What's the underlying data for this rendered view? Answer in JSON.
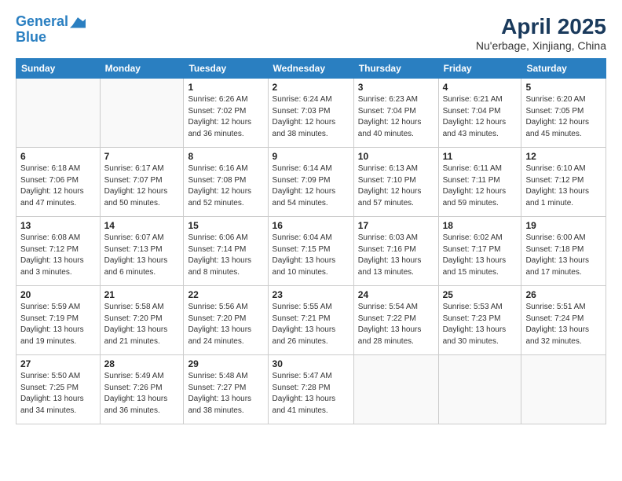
{
  "logo": {
    "line1": "General",
    "line2": "Blue"
  },
  "title": "April 2025",
  "subtitle": "Nu'erbage, Xinjiang, China",
  "days_header": [
    "Sunday",
    "Monday",
    "Tuesday",
    "Wednesday",
    "Thursday",
    "Friday",
    "Saturday"
  ],
  "weeks": [
    [
      {
        "day": "",
        "detail": ""
      },
      {
        "day": "",
        "detail": ""
      },
      {
        "day": "1",
        "detail": "Sunrise: 6:26 AM\nSunset: 7:02 PM\nDaylight: 12 hours\nand 36 minutes."
      },
      {
        "day": "2",
        "detail": "Sunrise: 6:24 AM\nSunset: 7:03 PM\nDaylight: 12 hours\nand 38 minutes."
      },
      {
        "day": "3",
        "detail": "Sunrise: 6:23 AM\nSunset: 7:04 PM\nDaylight: 12 hours\nand 40 minutes."
      },
      {
        "day": "4",
        "detail": "Sunrise: 6:21 AM\nSunset: 7:04 PM\nDaylight: 12 hours\nand 43 minutes."
      },
      {
        "day": "5",
        "detail": "Sunrise: 6:20 AM\nSunset: 7:05 PM\nDaylight: 12 hours\nand 45 minutes."
      }
    ],
    [
      {
        "day": "6",
        "detail": "Sunrise: 6:18 AM\nSunset: 7:06 PM\nDaylight: 12 hours\nand 47 minutes."
      },
      {
        "day": "7",
        "detail": "Sunrise: 6:17 AM\nSunset: 7:07 PM\nDaylight: 12 hours\nand 50 minutes."
      },
      {
        "day": "8",
        "detail": "Sunrise: 6:16 AM\nSunset: 7:08 PM\nDaylight: 12 hours\nand 52 minutes."
      },
      {
        "day": "9",
        "detail": "Sunrise: 6:14 AM\nSunset: 7:09 PM\nDaylight: 12 hours\nand 54 minutes."
      },
      {
        "day": "10",
        "detail": "Sunrise: 6:13 AM\nSunset: 7:10 PM\nDaylight: 12 hours\nand 57 minutes."
      },
      {
        "day": "11",
        "detail": "Sunrise: 6:11 AM\nSunset: 7:11 PM\nDaylight: 12 hours\nand 59 minutes."
      },
      {
        "day": "12",
        "detail": "Sunrise: 6:10 AM\nSunset: 7:12 PM\nDaylight: 13 hours\nand 1 minute."
      }
    ],
    [
      {
        "day": "13",
        "detail": "Sunrise: 6:08 AM\nSunset: 7:12 PM\nDaylight: 13 hours\nand 3 minutes."
      },
      {
        "day": "14",
        "detail": "Sunrise: 6:07 AM\nSunset: 7:13 PM\nDaylight: 13 hours\nand 6 minutes."
      },
      {
        "day": "15",
        "detail": "Sunrise: 6:06 AM\nSunset: 7:14 PM\nDaylight: 13 hours\nand 8 minutes."
      },
      {
        "day": "16",
        "detail": "Sunrise: 6:04 AM\nSunset: 7:15 PM\nDaylight: 13 hours\nand 10 minutes."
      },
      {
        "day": "17",
        "detail": "Sunrise: 6:03 AM\nSunset: 7:16 PM\nDaylight: 13 hours\nand 13 minutes."
      },
      {
        "day": "18",
        "detail": "Sunrise: 6:02 AM\nSunset: 7:17 PM\nDaylight: 13 hours\nand 15 minutes."
      },
      {
        "day": "19",
        "detail": "Sunrise: 6:00 AM\nSunset: 7:18 PM\nDaylight: 13 hours\nand 17 minutes."
      }
    ],
    [
      {
        "day": "20",
        "detail": "Sunrise: 5:59 AM\nSunset: 7:19 PM\nDaylight: 13 hours\nand 19 minutes."
      },
      {
        "day": "21",
        "detail": "Sunrise: 5:58 AM\nSunset: 7:20 PM\nDaylight: 13 hours\nand 21 minutes."
      },
      {
        "day": "22",
        "detail": "Sunrise: 5:56 AM\nSunset: 7:20 PM\nDaylight: 13 hours\nand 24 minutes."
      },
      {
        "day": "23",
        "detail": "Sunrise: 5:55 AM\nSunset: 7:21 PM\nDaylight: 13 hours\nand 26 minutes."
      },
      {
        "day": "24",
        "detail": "Sunrise: 5:54 AM\nSunset: 7:22 PM\nDaylight: 13 hours\nand 28 minutes."
      },
      {
        "day": "25",
        "detail": "Sunrise: 5:53 AM\nSunset: 7:23 PM\nDaylight: 13 hours\nand 30 minutes."
      },
      {
        "day": "26",
        "detail": "Sunrise: 5:51 AM\nSunset: 7:24 PM\nDaylight: 13 hours\nand 32 minutes."
      }
    ],
    [
      {
        "day": "27",
        "detail": "Sunrise: 5:50 AM\nSunset: 7:25 PM\nDaylight: 13 hours\nand 34 minutes."
      },
      {
        "day": "28",
        "detail": "Sunrise: 5:49 AM\nSunset: 7:26 PM\nDaylight: 13 hours\nand 36 minutes."
      },
      {
        "day": "29",
        "detail": "Sunrise: 5:48 AM\nSunset: 7:27 PM\nDaylight: 13 hours\nand 38 minutes."
      },
      {
        "day": "30",
        "detail": "Sunrise: 5:47 AM\nSunset: 7:28 PM\nDaylight: 13 hours\nand 41 minutes."
      },
      {
        "day": "",
        "detail": ""
      },
      {
        "day": "",
        "detail": ""
      },
      {
        "day": "",
        "detail": ""
      }
    ]
  ]
}
